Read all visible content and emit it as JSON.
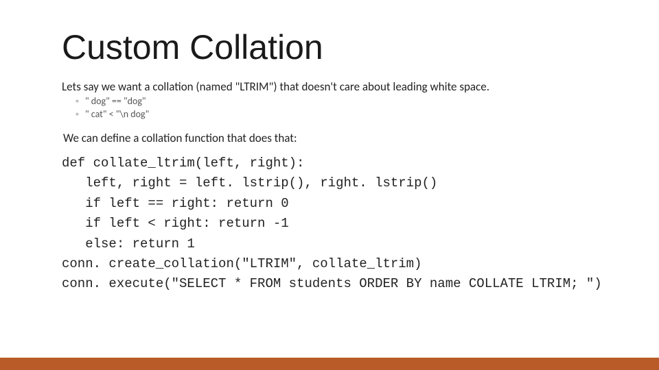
{
  "title": "Custom Collation",
  "intro": "Lets say we want a collation (named \"LTRIM\") that doesn't care about leading white space.",
  "bullets": {
    "b1": "\"   dog\" == \"dog\"",
    "b2": "\"   cat\" < \"\\n   dog\""
  },
  "desc": "We can define a collation function that does that:",
  "code": "def collate_ltrim(left, right):\n   left, right = left. lstrip(), right. lstrip()\n   if left == right: return 0\n   if left < right: return -1\n   else: return 1\nconn. create_collation(\"LTRIM\", collate_ltrim)\nconn. execute(\"SELECT * FROM students ORDER BY name COLLATE LTRIM; \")",
  "accent_color": "#B85B28"
}
